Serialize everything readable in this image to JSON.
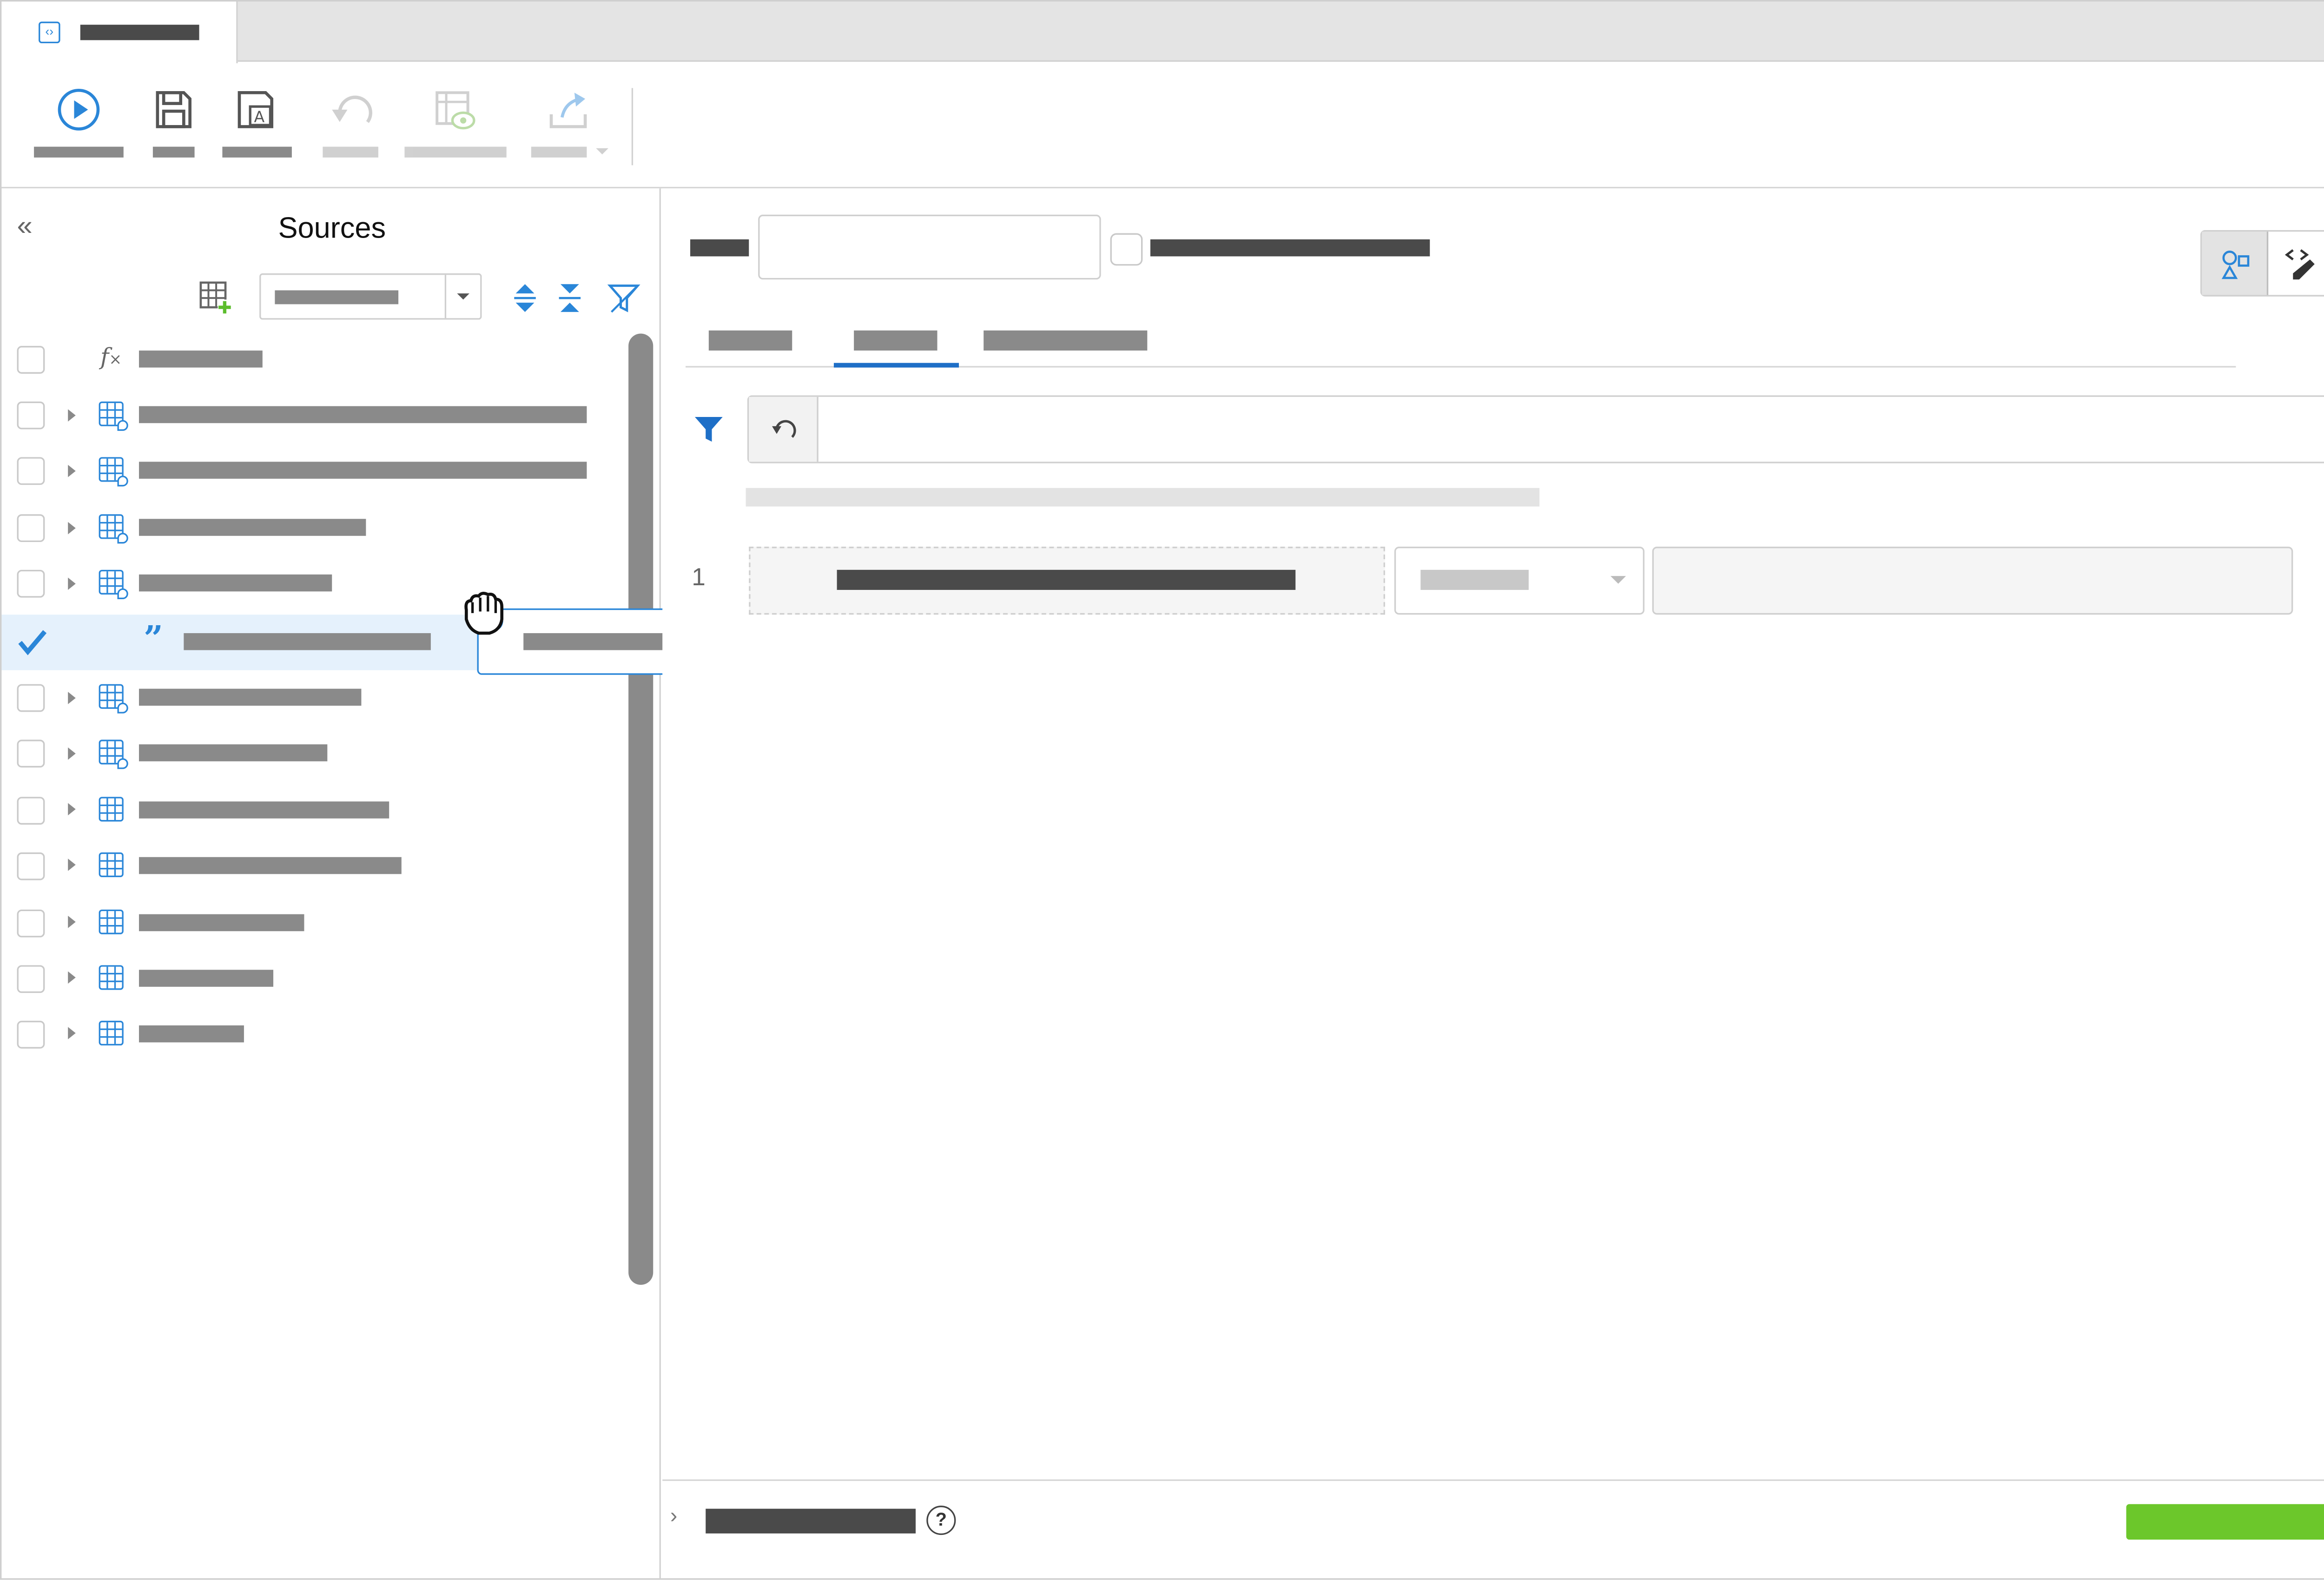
{
  "sources_panel": {
    "title": "Sources"
  },
  "colors": {
    "accent_blue": "#2a86d8",
    "active_tab_underline": "#1e6fc7",
    "run_button_green": "#6cc72b",
    "selected_row_bg": "#e5f1fc",
    "scrollbar": "#8a8a8a"
  },
  "icons": {
    "toolbar": [
      "run-icon",
      "save-icon",
      "save-as-icon",
      "undo-icon",
      "preview-icon",
      "export-icon"
    ],
    "sources_toolbar": [
      "add-table-icon",
      "expand-all-icon",
      "collapse-all-icon",
      "filter-outline-icon"
    ],
    "right_rail": [
      "collapse-right-icon",
      "gear-icon",
      "settings-doc-icon",
      "sliders-icon"
    ]
  },
  "tree": {
    "rows": [
      {
        "kind": "function",
        "checked": false
      },
      {
        "kind": "calc-table",
        "checked": false
      },
      {
        "kind": "calc-table",
        "checked": false
      },
      {
        "kind": "calc-table",
        "checked": false
      },
      {
        "kind": "calc-table",
        "checked": false
      },
      {
        "kind": "string-field",
        "checked": true
      },
      {
        "kind": "calc-table",
        "checked": false
      },
      {
        "kind": "calc-table",
        "checked": false
      },
      {
        "kind": "table",
        "checked": false
      },
      {
        "kind": "table",
        "checked": false
      },
      {
        "kind": "table",
        "checked": false
      },
      {
        "kind": "table",
        "checked": false
      },
      {
        "kind": "table",
        "checked": false
      }
    ]
  },
  "condition_rows": [
    {
      "number": "1"
    }
  ]
}
